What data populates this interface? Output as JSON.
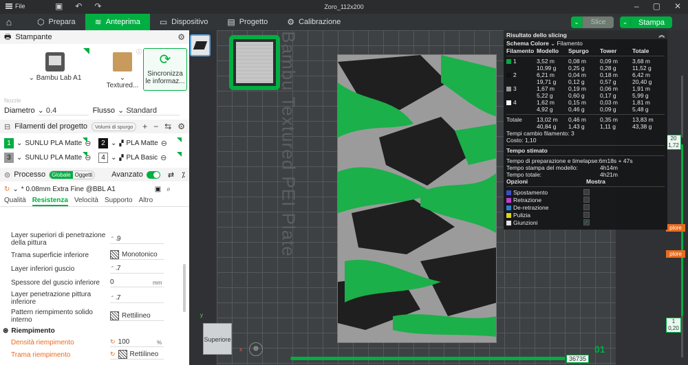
{
  "titlebar": {
    "file_label": "File",
    "title": "Zoro_112x200",
    "save_icon": "save-icon",
    "undo_icon": "undo-icon",
    "redo_icon": "redo-icon"
  },
  "tabs": [
    {
      "label": "Prepara",
      "icon": "cube-icon"
    },
    {
      "label": "Anteprima",
      "icon": "layers-icon"
    },
    {
      "label": "Dispositivo",
      "icon": "monitor-icon"
    },
    {
      "label": "Progetto",
      "icon": "document-icon"
    },
    {
      "label": "Calibrazione",
      "icon": "gear-icon"
    }
  ],
  "actions": {
    "slice": "Slice",
    "print": "Stampa"
  },
  "printer": {
    "section": "Stampante",
    "model": "Bambu Lab A1",
    "plate": "Textured...",
    "sync_l1": "Sincronizza",
    "sync_l2": "le informaz..."
  },
  "nozzle": {
    "faint": "Nozzle",
    "diam_label": "Diametro",
    "diam_value": "0.4",
    "flow_label": "Flusso",
    "flow_value": "Standard"
  },
  "filaments": {
    "title": "Filamenti del progetto",
    "purge": "Volumi di spurgo",
    "items": [
      {
        "num": "1",
        "name": "SUNLU PLA Matte",
        "color": "#00ae42"
      },
      {
        "num": "2",
        "name": "PLA Matte",
        "color": "#111111"
      },
      {
        "num": "3",
        "name": "SUNLU PLA Matte",
        "color": "#9a9a9a"
      },
      {
        "num": "4",
        "name": "PLA Basic",
        "color": "#ffffff"
      }
    ]
  },
  "process": {
    "title": "Processo",
    "global": "Globale",
    "objects": "Oggetti",
    "advanced": "Avanzato",
    "preset": "* 0.08mm Extra Fine @BBL A1",
    "tabs": [
      "Qualità",
      "Resistenza",
      "Velocità",
      "Supporto",
      "Altro"
    ]
  },
  "settings": [
    {
      "label": "Layer superiori di penetrazione della pittura",
      "value": "9",
      "kind": "spin"
    },
    {
      "label": "Trama superficie inferiore",
      "value": "Monotonico",
      "kind": "pattern"
    },
    {
      "label": "Layer inferiori guscio",
      "value": "7",
      "kind": "spin"
    },
    {
      "label": "Spessore del guscio inferiore",
      "value": "0",
      "kind": "plain",
      "unit": "mm"
    },
    {
      "label": "Layer penetrazione pittura inferiore",
      "value": "7",
      "kind": "spin"
    },
    {
      "label": "Pattern riempimento solido interno",
      "value": "Rettilineo",
      "kind": "pattern"
    }
  ],
  "infill": {
    "title": "Riempimento",
    "density_label": "Densità riempimento",
    "density_value": "100",
    "density_unit": "%",
    "pattern_label": "Trama riempimento",
    "pattern_value": "Rettilineo"
  },
  "viewport": {
    "plate_label": "Bambu Textured PEI Plate",
    "cube_label": "Superiore",
    "x_axis": "x",
    "y_axis": "y",
    "h_value": "36735",
    "layer_num": "01",
    "v_top": [
      "20",
      "1,72"
    ],
    "v_bottom": [
      "1",
      "0,20"
    ],
    "orange_tag": "plore"
  },
  "results": {
    "title": "Risultato dello slicing",
    "scheme_label": "Schema Colore",
    "scheme_value": "Filamento",
    "headers": [
      "Filamento",
      "Modello",
      "Spurgo",
      "Tower",
      "Totale"
    ],
    "rows": [
      {
        "id": "1",
        "color": "#00ae42",
        "m": [
          "3,52 m",
          "10,99 g"
        ],
        "s": [
          "0,08 m",
          "0,25 g"
        ],
        "t": [
          "0,09 m",
          "0,28 g"
        ],
        "tot": [
          "3,68 m",
          "11,52 g"
        ]
      },
      {
        "id": "2",
        "color": "#111111",
        "m": [
          "6,21 m",
          "19,71 g"
        ],
        "s": [
          "0,04 m",
          "0,12 g"
        ],
        "t": [
          "0,18 m",
          "0,57 g"
        ],
        "tot": [
          "6,42 m",
          "20,40 g"
        ]
      },
      {
        "id": "3",
        "color": "#9a9a9a",
        "m": [
          "1,67 m",
          "5,22 g"
        ],
        "s": [
          "0,19 m",
          "0,60 g"
        ],
        "t": [
          "0,06 m",
          "0,17 g"
        ],
        "tot": [
          "1,91 m",
          "5,99 g"
        ]
      },
      {
        "id": "4",
        "color": "#ffffff",
        "m": [
          "1,62 m",
          "4,92 g"
        ],
        "s": [
          "0,15 m",
          "0,46 g"
        ],
        "t": [
          "0,03 m",
          "0,09 g"
        ],
        "tot": [
          "1,81 m",
          "5,48 g"
        ]
      }
    ],
    "total": {
      "label": "Totale",
      "m": [
        "13,02 m",
        "40,84 g"
      ],
      "s": [
        "0,46 m",
        "1,43 g"
      ],
      "t": [
        "0,35 m",
        "1,11 g"
      ],
      "tot": [
        "13,83 m",
        "43,38 g"
      ]
    },
    "changes": "Tempi cambio filamento: 3",
    "cost": "Costo: 1,10",
    "time_title": "Tempo stimato",
    "times": [
      {
        "label": "Tempo di preparazione e timelapse:",
        "value": "6m18s + 47s"
      },
      {
        "label": "Tempo stampa del modello:",
        "value": "4h14m"
      },
      {
        "label": "Tempo totale:",
        "value": "4h21m"
      }
    ],
    "options_title": "Opzioni",
    "show_title": "Mostra",
    "options": [
      {
        "name": "Spostamento",
        "color": "#3b4fd0",
        "checked": false
      },
      {
        "name": "Retrazione",
        "color": "#c23fd4",
        "checked": false
      },
      {
        "name": "De-retrazione",
        "color": "#2d7fd3",
        "checked": false
      },
      {
        "name": "Pulizia",
        "color": "#e8d81a",
        "checked": false
      },
      {
        "name": "Giunzioni",
        "color": "#e8e8e8",
        "checked": true
      }
    ]
  }
}
